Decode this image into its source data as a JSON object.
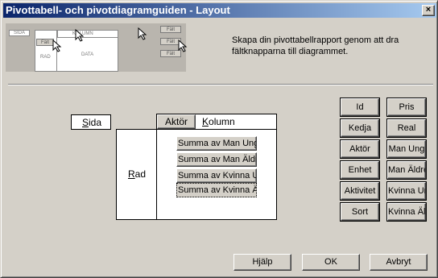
{
  "window": {
    "title": "Pivottabell- och pivotdiagramguiden - Layout",
    "close_glyph": "×"
  },
  "description": "Skapa din pivottabellrapport genom att dra fältknapparna till diagrammet.",
  "preview": {
    "page_label": "SIDA",
    "row_label": "RAD",
    "column_label": "KOLUMN",
    "data_label": "DATA",
    "field_buttons": [
      "Fält",
      "Fält",
      "Fält",
      "Fält"
    ]
  },
  "layout": {
    "page_area": {
      "label_pre": "",
      "label_u": "S",
      "label_post": "ida"
    },
    "row_area": {
      "label_pre": "",
      "label_u": "R",
      "label_post": "ad"
    },
    "column_area": {
      "field": "Aktör",
      "label_pre": "",
      "label_u": "K",
      "label_post": "olumn"
    },
    "data_fields": [
      "Summa av Man Ung",
      "Summa av Man Äldre",
      "Summa av Kvinna Ung",
      "Summa av Kvinna Äldre"
    ]
  },
  "fields": {
    "left": [
      "Id",
      "Kedja",
      "Aktör",
      "Enhet",
      "Aktivitet",
      "Sort"
    ],
    "right": [
      "Pris",
      "Real",
      "Man Ung",
      "Man Äldre",
      "Kvinna Ung",
      "Kvinna Äldre"
    ]
  },
  "buttons": {
    "help_pre": "H",
    "help_u": "j",
    "help_post": "älp",
    "ok": "OK",
    "cancel": "Avbryt"
  }
}
